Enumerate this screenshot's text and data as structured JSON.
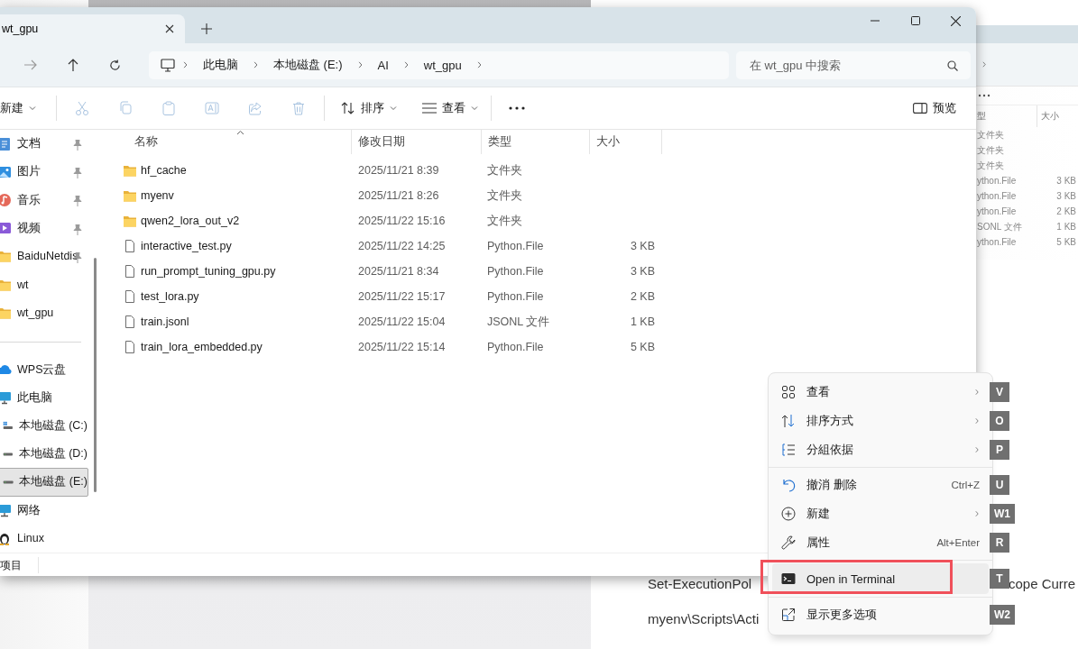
{
  "background_page": {
    "lines": [
      {
        "left": "Set-ExecutionPol",
        "right": "cope Curre"
      },
      {
        "left": "myenv\\Scripts\\Acti"
      }
    ]
  },
  "back_window": {
    "columns": [
      "型",
      "大小"
    ],
    "rows": [
      {
        "type": "文件夹"
      },
      {
        "type": "文件夹"
      },
      {
        "type": "文件夹"
      },
      {
        "type": "ython.File",
        "size": "3 KB"
      },
      {
        "type": "ython.File",
        "size": "3 KB"
      },
      {
        "type": "ython.File",
        "size": "2 KB"
      },
      {
        "type": "SONL 文件",
        "size": "1 KB"
      },
      {
        "type": "ython.File",
        "size": "5 KB"
      }
    ]
  },
  "explorer": {
    "tabs": [
      {
        "label": "wt_gpu",
        "selected": true
      }
    ],
    "breadcrumbs": [
      "此电脑",
      "本地磁盘 (E:)",
      "AI",
      "wt_gpu"
    ],
    "search": {
      "placeholder": "在 wt_gpu 中搜索"
    },
    "toolbar": {
      "new_label": "新建",
      "sort_label": "排序",
      "view_label": "查看",
      "preview_label": "预览"
    },
    "sidebar": {
      "quick_access": [
        {
          "label": "文档",
          "kind": "documents",
          "pinned": true,
          "selected": false
        },
        {
          "label": "图片",
          "kind": "pictures",
          "pinned": true,
          "selected": false
        },
        {
          "label": "音乐",
          "kind": "music",
          "pinned": true,
          "selected": false
        },
        {
          "label": "视频",
          "kind": "videos",
          "pinned": true,
          "selected": false
        },
        {
          "label": "BaiduNetdis",
          "kind": "folder",
          "pinned": true,
          "selected": false
        },
        {
          "label": "wt",
          "kind": "folder",
          "pinned": false,
          "selected": false
        },
        {
          "label": "wt_gpu",
          "kind": "folder",
          "pinned": false,
          "selected": false
        }
      ],
      "locations": [
        {
          "label": "WPS云盘",
          "kind": "cloud",
          "selected": false
        },
        {
          "label": "此电脑",
          "kind": "computer",
          "selected": false,
          "children": [
            {
              "label": "本地磁盘 (C:)",
              "kind": "systemdrive",
              "selected": false
            },
            {
              "label": "本地磁盘 (D:)",
              "kind": "drive",
              "selected": false
            },
            {
              "label": "本地磁盘 (E:)",
              "kind": "drive",
              "selected": true
            }
          ]
        },
        {
          "label": "网络",
          "kind": "network",
          "selected": false
        },
        {
          "label": "Linux",
          "kind": "linux",
          "selected": false
        }
      ]
    },
    "columns": [
      {
        "label": "名称",
        "sorted": true
      },
      {
        "label": "修改日期"
      },
      {
        "label": "类型"
      },
      {
        "label": "大小"
      }
    ],
    "files": [
      {
        "name": "hf_cache",
        "modified": "2025/11/21 8:39",
        "type": "文件夹",
        "kind": "folder"
      },
      {
        "name": "myenv",
        "modified": "2025/11/21 8:26",
        "type": "文件夹",
        "kind": "folder"
      },
      {
        "name": "qwen2_lora_out_v2",
        "modified": "2025/11/22 15:16",
        "type": "文件夹",
        "kind": "folder"
      },
      {
        "name": "interactive_test.py",
        "modified": "2025/11/22 14:25",
        "type": "Python.File",
        "size": "3 KB",
        "kind": "file"
      },
      {
        "name": "run_prompt_tuning_gpu.py",
        "modified": "2025/11/21 8:34",
        "type": "Python.File",
        "size": "3 KB",
        "kind": "file"
      },
      {
        "name": "test_lora.py",
        "modified": "2025/11/22 15:17",
        "type": "Python.File",
        "size": "2 KB",
        "kind": "file"
      },
      {
        "name": "train.jsonl",
        "modified": "2025/11/22 15:04",
        "type": "JSONL 文件",
        "size": "1 KB",
        "kind": "file"
      },
      {
        "name": "train_lora_embedded.py",
        "modified": "2025/11/22 15:14",
        "type": "Python.File",
        "size": "5 KB",
        "kind": "file"
      }
    ],
    "status_bar": "项目"
  },
  "context_menu": {
    "items": [
      {
        "kind": "item",
        "label": "查看",
        "submenu": true,
        "access_key": "V",
        "selected": false
      },
      {
        "kind": "item",
        "label": "排序方式",
        "submenu": true,
        "access_key": "O",
        "selected": false
      },
      {
        "kind": "item",
        "label": "分組依据",
        "submenu": true,
        "access_key": "P",
        "selected": false
      },
      {
        "kind": "separator"
      },
      {
        "kind": "item",
        "label": "撤消 删除",
        "shortcut": "Ctrl+Z",
        "access_key": "U",
        "selected": false
      },
      {
        "kind": "item",
        "label": "新建",
        "submenu": true,
        "access_key": "W1",
        "selected": false
      },
      {
        "kind": "item",
        "label": "属性",
        "shortcut": "Alt+Enter",
        "access_key": "R",
        "selected": false
      },
      {
        "kind": "separator"
      },
      {
        "kind": "item",
        "label": "Open in Terminal",
        "access_key": "T",
        "selected": true,
        "annotated": true
      },
      {
        "kind": "separator"
      },
      {
        "kind": "item",
        "label": "显示更多选项",
        "access_key": "W2",
        "selected": false
      }
    ]
  }
}
